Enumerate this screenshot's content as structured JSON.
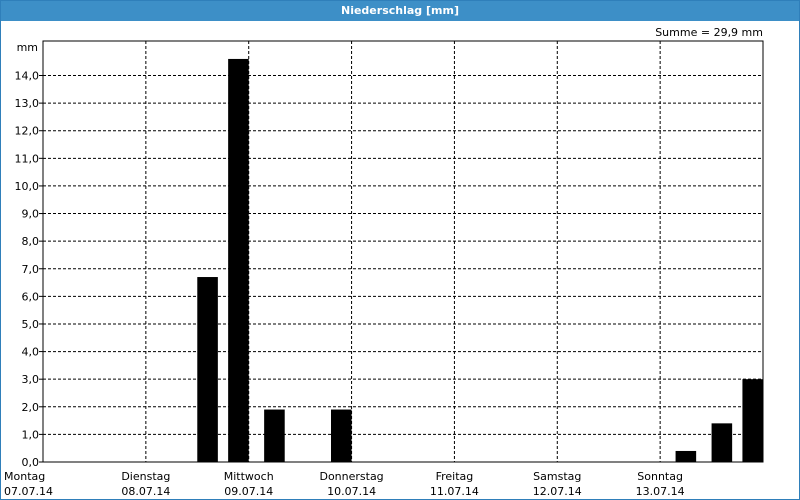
{
  "title": "Niederschlag [mm]",
  "summary": "Summe = 29,9 mm",
  "colors": {
    "titlebar": "#3d8fc7",
    "bar": "#000000",
    "grid": "#000000"
  },
  "chart_data": {
    "type": "bar",
    "title": "Niederschlag [mm]",
    "ylabel": "mm",
    "ylim": [
      0,
      15
    ],
    "y_ticks": [
      "0,0",
      "1,0",
      "2,0",
      "3,0",
      "4,0",
      "5,0",
      "6,0",
      "7,0",
      "8,0",
      "9,0",
      "10,0",
      "11,0",
      "12,0",
      "13,0",
      "14,0"
    ],
    "grid": true,
    "day_labels": [
      {
        "weekday": "Montag",
        "date": "07.07.14"
      },
      {
        "weekday": "Dienstag",
        "date": "08.07.14"
      },
      {
        "weekday": "Mittwoch",
        "date": "09.07.14"
      },
      {
        "weekday": "Donnerstag",
        "date": "10.07.14"
      },
      {
        "weekday": "Freitag",
        "date": "11.07.14"
      },
      {
        "weekday": "Samstag",
        "date": "12.07.14"
      },
      {
        "weekday": "Sonntag",
        "date": "13.07.14"
      }
    ],
    "x_range_days": [
      0,
      7
    ],
    "bar_width_days": 0.2,
    "bars": [
      {
        "x": 1.5,
        "value": 6.7
      },
      {
        "x": 1.8,
        "value": 14.6
      },
      {
        "x": 2.15,
        "value": 1.9
      },
      {
        "x": 2.8,
        "value": 1.9
      },
      {
        "x": 6.15,
        "value": 0.4
      },
      {
        "x": 6.5,
        "value": 1.4
      },
      {
        "x": 6.8,
        "value": 3.0
      }
    ],
    "total": 29.9
  }
}
